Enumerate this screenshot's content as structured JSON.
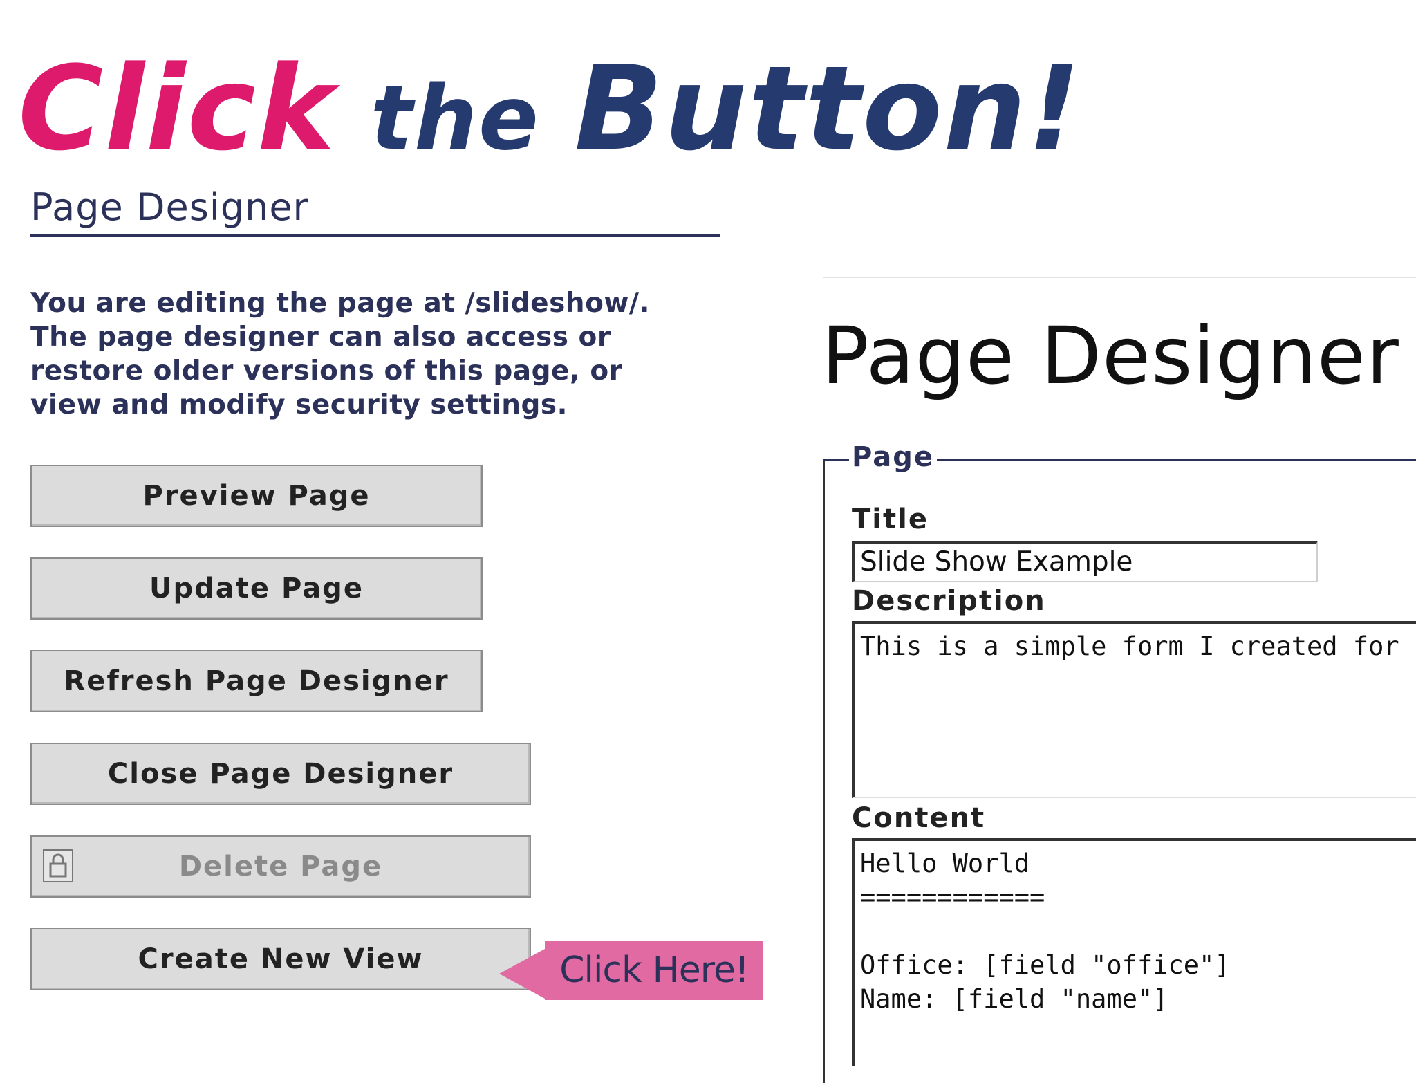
{
  "headline": {
    "click": "Click",
    "the": "the",
    "button": "Button!",
    "colors": {
      "pink": "#dd1a6c",
      "navy": "#253a6f"
    }
  },
  "left_panel": {
    "title": "Page Designer",
    "intro_lines": [
      "You are editing the page at /slideshow/.",
      "The page designer can also access or",
      "restore older versions of this page, or",
      "view and modify security settings."
    ],
    "buttons": {
      "preview": "Preview Page",
      "update": "Update Page",
      "refresh": "Refresh Page Designer",
      "close": "Close Page Designer",
      "delete": "Delete Page",
      "create_view": "Create New View"
    },
    "delete_icon": "lock-icon"
  },
  "callout": {
    "text": "Click Here!",
    "color": "#e26aa3"
  },
  "right_panel": {
    "title": "Page Designer",
    "fieldset_legend": "Page",
    "title_label": "Title",
    "title_value": "Slide Show Example",
    "description_label": "Description",
    "description_value": "This is a simple form I created for",
    "content_label": "Content",
    "content_lines": [
      "Hello World",
      "============",
      "",
      "Office: [field \"office\"]",
      "Name: [field \"name\"]"
    ]
  }
}
